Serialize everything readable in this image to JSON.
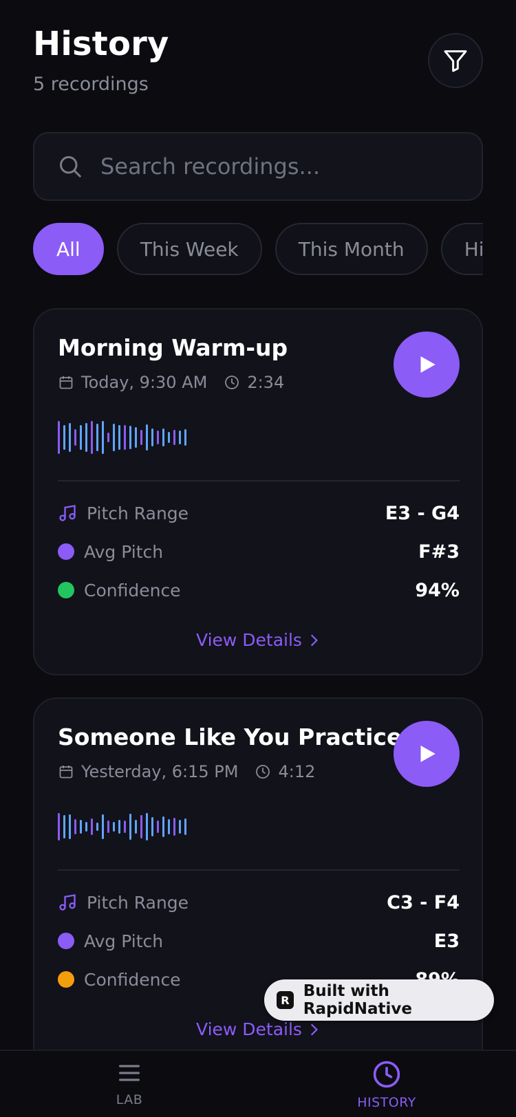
{
  "header": {
    "title": "History",
    "subtitle": "5 recordings",
    "filter_icon": "filter-icon"
  },
  "search": {
    "placeholder": "Search recordings...",
    "icon": "search-icon"
  },
  "filters": [
    {
      "label": "All",
      "active": true
    },
    {
      "label": "This Week",
      "active": false
    },
    {
      "label": "This Month",
      "active": false
    },
    {
      "label": "High",
      "active": false
    }
  ],
  "recordings": [
    {
      "title": "Morning Warm-up",
      "date": "Today, 9:30 AM",
      "duration": "2:34",
      "pitch_range_label": "Pitch Range",
      "pitch_range": "E3 - G4",
      "avg_pitch_label": "Avg Pitch",
      "avg_pitch": "F#3",
      "confidence_label": "Confidence",
      "confidence": "94%",
      "confidence_color": "#22c55e",
      "details_label": "View Details"
    },
    {
      "title": "Someone Like You Practice",
      "date": "Yesterday, 6:15 PM",
      "duration": "4:12",
      "pitch_range_label": "Pitch Range",
      "pitch_range": "C3 - F4",
      "avg_pitch_label": "Avg Pitch",
      "avg_pitch": "E3",
      "confidence_label": "Confidence",
      "confidence": "89%",
      "confidence_color": "#f59e0b",
      "details_label": "View Details"
    }
  ],
  "badge": {
    "label": "Built with RapidNative"
  },
  "nav": [
    {
      "label": "LAB",
      "icon": "menu-icon",
      "active": false
    },
    {
      "label": "HISTORY",
      "icon": "clock-icon",
      "active": true
    }
  ],
  "colors": {
    "accent": "#8b5cf6",
    "background": "#0b0b10",
    "card": "#12121b"
  }
}
